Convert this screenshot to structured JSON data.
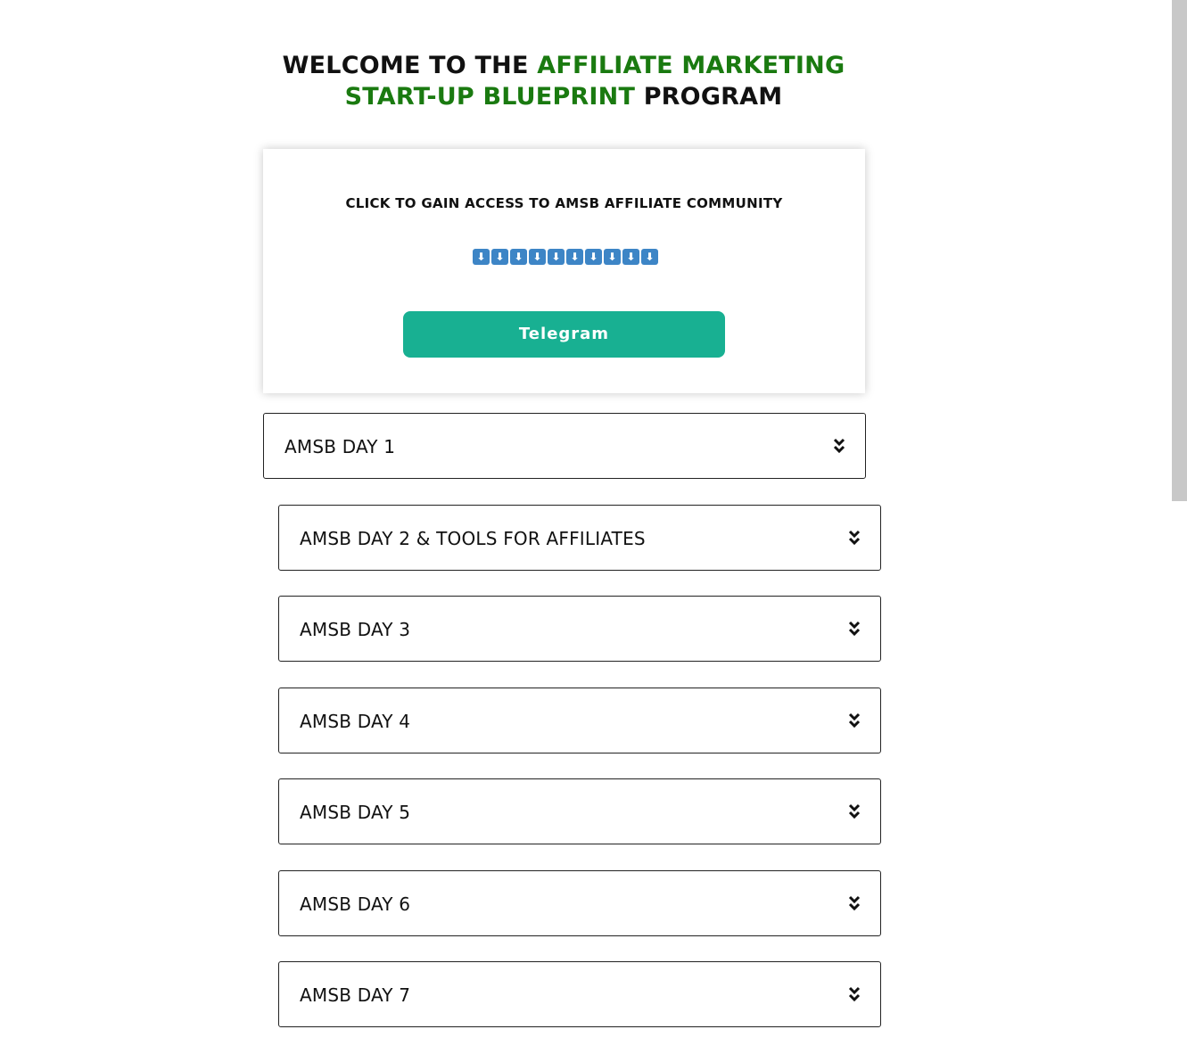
{
  "header": {
    "line1_prefix": "WELCOME TO THE ",
    "line1_highlight": "AFFILIATE MARKETING",
    "line2_highlight": "START-UP BLUEPRINT",
    "line2_suffix": " PROGRAM",
    "highlight_color": "#1a7a10"
  },
  "community_card": {
    "title": "CLICK TO GAIN ACCESS TO AMSB AFFILIATE COMMUNITY",
    "arrow_glyph": "⬇",
    "arrow_icon": "down-arrow-box-icon",
    "button_label": "Telegram",
    "button_color": "#18b092",
    "arrow_color": "#3d85c6"
  },
  "accordions": [
    {
      "label": "AMSB DAY 1",
      "icon": "double-chevron-down-icon"
    },
    {
      "label": "AMSB DAY 2 & TOOLS FOR AFFILIATES",
      "icon": "double-chevron-down-icon"
    },
    {
      "label": "AMSB DAY 3",
      "icon": "double-chevron-down-icon"
    },
    {
      "label": "AMSB DAY 4",
      "icon": "double-chevron-down-icon"
    },
    {
      "label": "AMSB DAY 5",
      "icon": "double-chevron-down-icon"
    },
    {
      "label": "AMSB DAY 6",
      "icon": "double-chevron-down-icon"
    },
    {
      "label": "AMSB DAY 7",
      "icon": "double-chevron-down-icon"
    }
  ]
}
